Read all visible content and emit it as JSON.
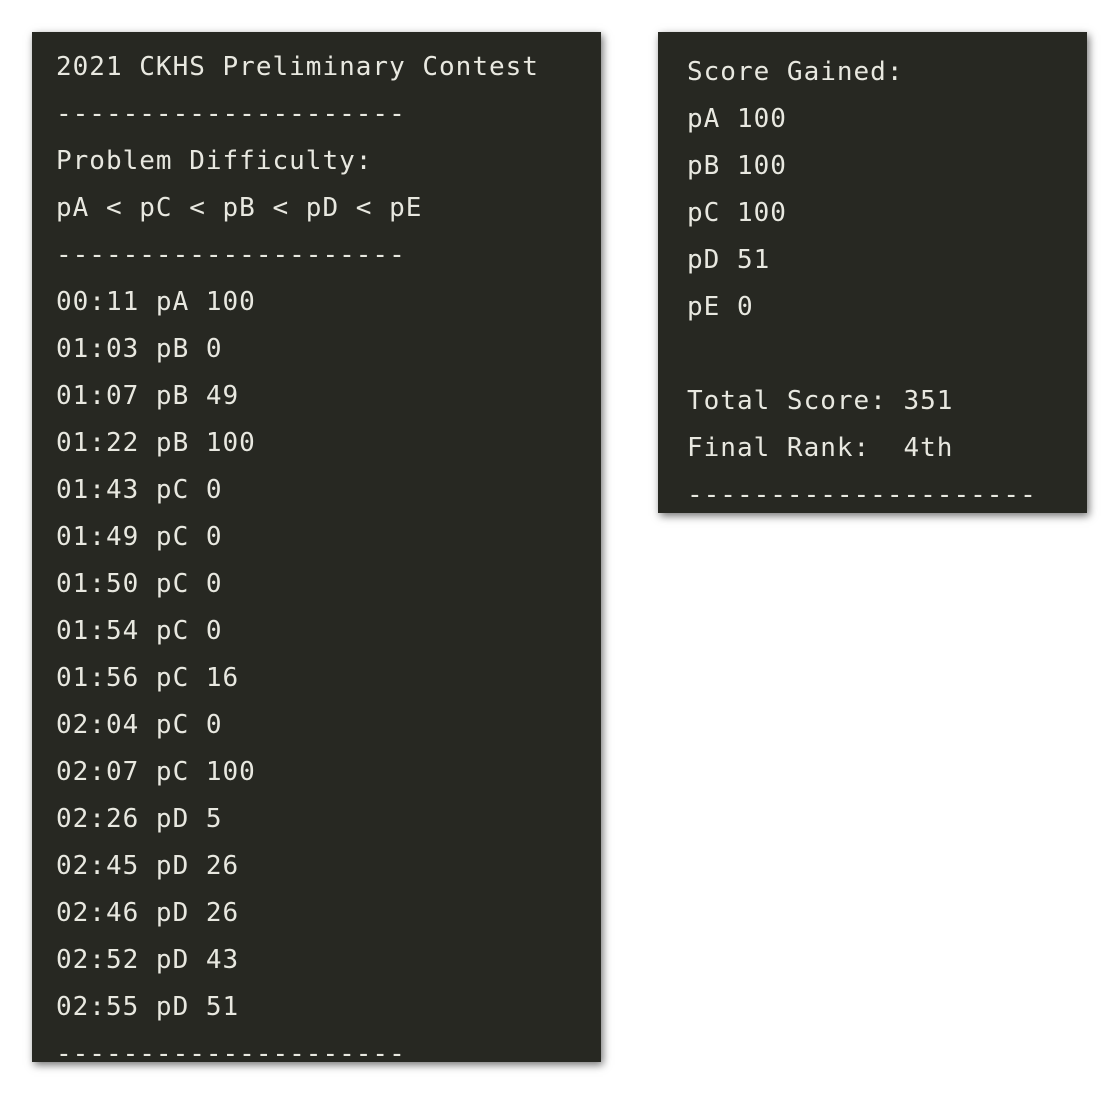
{
  "left_panel": {
    "title": "2021 CKHS Preliminary Contest",
    "separator": "---------------------",
    "difficulty_heading": "Problem Difficulty:",
    "difficulty_order": "pA < pC < pB < pD < pE",
    "log": [
      "00:11 pA 100",
      "01:03 pB 0",
      "01:07 pB 49",
      "01:22 pB 100",
      "01:43 pC 0",
      "01:49 pC 0",
      "01:50 pC 0",
      "01:54 pC 0",
      "01:56 pC 16",
      "02:04 pC 0",
      "02:07 pC 100",
      "02:26 pD 5",
      "02:45 pD 26",
      "02:46 pD 26",
      "02:52 pD 43",
      "02:55 pD 51"
    ]
  },
  "right_panel": {
    "heading": "Score Gained:",
    "scores": [
      "pA 100",
      "pB 100",
      "pC 100",
      "pD 51",
      "pE 0"
    ],
    "total": "Total Score: 351",
    "rank": "Final Rank:  4th",
    "separator": "---------------------"
  }
}
